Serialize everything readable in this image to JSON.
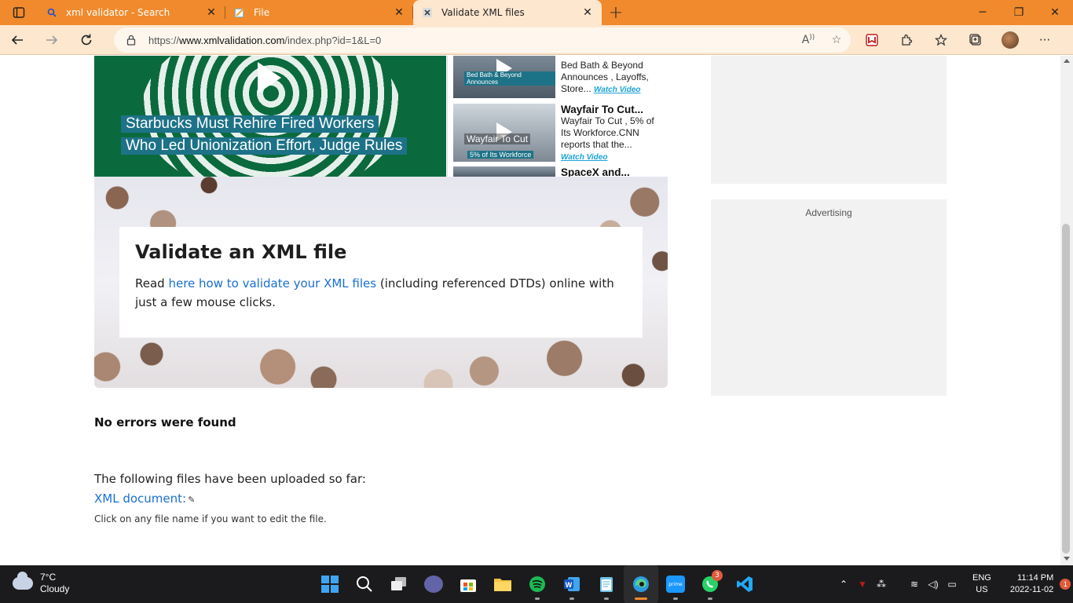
{
  "browser": {
    "tabs": [
      {
        "title": "xml validator - Search",
        "icon": "search-icon"
      },
      {
        "title": "File",
        "icon": "notepad-icon"
      },
      {
        "title": "Validate XML files",
        "icon": "tab-favicon"
      }
    ],
    "url_prefix": "https://",
    "url_host": "www.xmlvalidation.com",
    "url_rest": "/index.php?id=1&L=0",
    "colors": {
      "tabbar": "#f08a2c",
      "toolbar": "#fde7cf"
    }
  },
  "videos": {
    "main_caption_1": "Starbucks Must Rehire Fired Workers",
    "main_caption_2": "Who Led Unionization Effort, Judge Rules",
    "items": [
      {
        "title": "",
        "text": "Bed Bath & Beyond Announces , Layoffs, Store...",
        "watch": "Watch Video",
        "thumb_caption": "Bed Bath & Beyond Announces"
      },
      {
        "title": "Wayfair To Cut...",
        "text": "Wayfair To Cut , 5% of Its Workforce.CNN reports that the...",
        "watch": "Watch Video",
        "thumb_caption": "Wayfair To Cut",
        "thumb_caption2": "5% of Its Workforce"
      },
      {
        "title": "SpaceX and..."
      }
    ]
  },
  "ads": {
    "label": "Advertising"
  },
  "hero": {
    "title": "Validate an XML file",
    "text_before": "Read ",
    "link": "here how to validate your XML files",
    "text_after": " (including referenced DTDs) online with just a few mouse clicks."
  },
  "result": {
    "status": "No errors were found",
    "uploaded_label": "The following files have been uploaded so far:",
    "file_link": "XML document:",
    "hint": "Click on any file name if you want to edit the file."
  },
  "taskbar": {
    "weather_temp": "7°C",
    "weather_desc": "Cloudy",
    "lang_1": "ENG",
    "lang_2": "US",
    "time": "11:14 PM",
    "date": "2022-11-02",
    "notification_count": "1",
    "whatsapp_badge": "3"
  }
}
